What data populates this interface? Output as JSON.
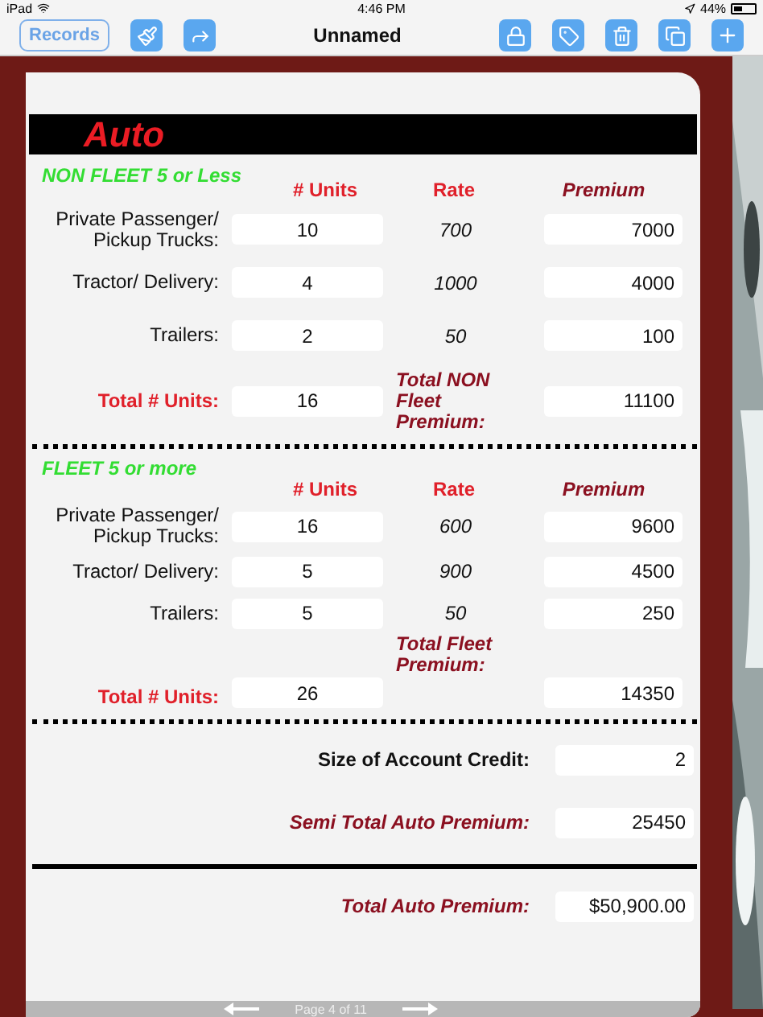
{
  "status_bar": {
    "device": "iPad",
    "time": "4:46 PM",
    "battery": "44%"
  },
  "toolbar": {
    "records": "Records",
    "title": "Unnamed"
  },
  "form": {
    "title": "Auto",
    "sections": [
      {
        "heading": "NON FLEET 5 or Less",
        "columns": [
          "# Units",
          "Rate",
          "Premium"
        ],
        "rows": [
          {
            "label": "Private Passenger/ Pickup Trucks:",
            "units": "10",
            "rate": "700",
            "premium": "7000"
          },
          {
            "label": "Tractor/ Delivery:",
            "units": "4",
            "rate": "1000",
            "premium": "4000"
          },
          {
            "label": "Trailers:",
            "units": "2",
            "rate": "50",
            "premium": "100"
          }
        ],
        "total_units_label": "Total # Units:",
        "total_units": "16",
        "total_premium_label": "Total NON Fleet Premium:",
        "total_premium": "11100"
      },
      {
        "heading": "FLEET 5 or more",
        "columns": [
          "# Units",
          "Rate",
          "Premium"
        ],
        "rows": [
          {
            "label": "Private Passenger/ Pickup Trucks:",
            "units": "16",
            "rate": "600",
            "premium": "9600"
          },
          {
            "label": "Tractor/ Delivery:",
            "units": "5",
            "rate": "900",
            "premium": "4500"
          },
          {
            "label": "Trailers:",
            "units": "5",
            "rate": "50",
            "premium": "250"
          }
        ],
        "total_units_label": "Total # Units:",
        "total_units": "26",
        "total_premium_label": "Total Fleet Premium:",
        "total_premium": "14350"
      }
    ],
    "credit_label": "Size of Account Credit:",
    "credit": "2",
    "semi_label": "Semi Total Auto Premium:",
    "semi": "25450",
    "total_label": "Total Auto Premium:",
    "total": "$50,900.00"
  },
  "footer": {
    "page": "Page 4 of 11"
  }
}
